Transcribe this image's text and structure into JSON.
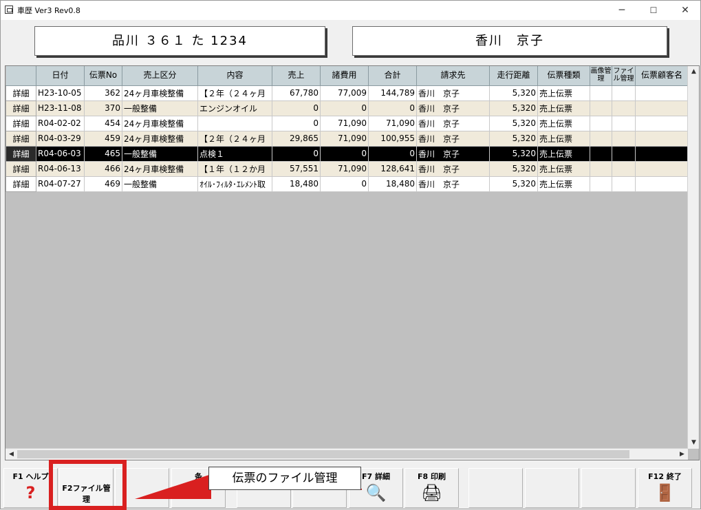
{
  "window": {
    "title": "車歴 Ver3 Rev0.8",
    "minimize": "─",
    "maximize": "☐",
    "close": "✕"
  },
  "header": {
    "plate": "品川 ３６１ た 1234",
    "owner": "香川　京子"
  },
  "columns": [
    "",
    "日付",
    "伝票No",
    "売上区分",
    "内容",
    "売上",
    "諸費用",
    "合計",
    "請求先",
    "走行距離",
    "伝票種類",
    "画像管理",
    "ファイル管理",
    "伝票顧客名"
  ],
  "rows": [
    {
      "btn": "詳細",
      "date": "H23-10-05",
      "no": "362",
      "kubun": "24ヶ月車検整備",
      "naiyo": "【２年（２４ヶ月",
      "uriage": "67,780",
      "shohiyo": "77,009",
      "gokei": "144,789",
      "seikyu": "香川　京子",
      "kyori": "5,320",
      "shurui": "売上伝票",
      "style": "odd"
    },
    {
      "btn": "詳細",
      "date": "H23-11-08",
      "no": "370",
      "kubun": "一般整備",
      "naiyo": "エンジンオイル",
      "uriage": "0",
      "shohiyo": "0",
      "gokei": "0",
      "seikyu": "香川　京子",
      "kyori": "5,320",
      "shurui": "売上伝票",
      "style": "even"
    },
    {
      "btn": "詳細",
      "date": "R04-02-02",
      "no": "454",
      "kubun": "24ヶ月車検整備",
      "naiyo": "",
      "uriage": "0",
      "shohiyo": "71,090",
      "gokei": "71,090",
      "seikyu": "香川　京子",
      "kyori": "5,320",
      "shurui": "売上伝票",
      "style": "odd"
    },
    {
      "btn": "詳細",
      "date": "R04-03-29",
      "no": "459",
      "kubun": "24ヶ月車検整備",
      "naiyo": "【２年（２４ヶ月",
      "uriage": "29,865",
      "shohiyo": "71,090",
      "gokei": "100,955",
      "seikyu": "香川　京子",
      "kyori": "5,320",
      "shurui": "売上伝票",
      "style": "even"
    },
    {
      "btn": "詳細",
      "date": "R04-06-03",
      "no": "465",
      "kubun": "一般整備",
      "naiyo": "点検１",
      "uriage": "0",
      "shohiyo": "0",
      "gokei": "0",
      "seikyu": "香川　京子",
      "kyori": "5,320",
      "shurui": "売上伝票",
      "style": "sel"
    },
    {
      "btn": "詳細",
      "date": "R04-06-13",
      "no": "466",
      "kubun": "24ヶ月車検整備",
      "naiyo": "【１年（１２か月",
      "uriage": "57,551",
      "shohiyo": "71,090",
      "gokei": "128,641",
      "seikyu": "香川　京子",
      "kyori": "5,320",
      "shurui": "売上伝票",
      "style": "even"
    },
    {
      "btn": "詳細",
      "date": "R04-07-27",
      "no": "469",
      "kubun": "一般整備",
      "naiyo": "ｵｲﾙ･ﾌｨﾙﾀ･ｴﾚﾒﾝﾄ取",
      "uriage": "18,480",
      "shohiyo": "0",
      "gokei": "18,480",
      "seikyu": "香川　京子",
      "kyori": "5,320",
      "shurui": "売上伝票",
      "style": "odd"
    }
  ],
  "fkeys": [
    {
      "label": "F1 ヘルプ",
      "icon": "help-icon",
      "glyph": "?"
    },
    {
      "label": "F2ファイル管理",
      "icon": "",
      "glyph": ""
    },
    {
      "label": "",
      "icon": "",
      "glyph": ""
    },
    {
      "label": "条",
      "icon": "",
      "glyph": ""
    },
    {
      "label": "",
      "icon": "",
      "glyph": ""
    },
    {
      "label": "",
      "icon": "",
      "glyph": ""
    },
    {
      "label": "F7 詳細",
      "icon": "magnifier-icon",
      "glyph": "🔍"
    },
    {
      "label": "F8 印刷",
      "icon": "printer-icon",
      "glyph": "🖨"
    },
    {
      "label": "",
      "icon": "",
      "glyph": ""
    },
    {
      "label": "",
      "icon": "",
      "glyph": ""
    },
    {
      "label": "",
      "icon": "",
      "glyph": ""
    },
    {
      "label": "F12 終了",
      "icon": "exit-door-icon",
      "glyph": "🚪"
    }
  ],
  "annotation": {
    "callout": "伝票のファイル管理",
    "color": "#d92020"
  }
}
